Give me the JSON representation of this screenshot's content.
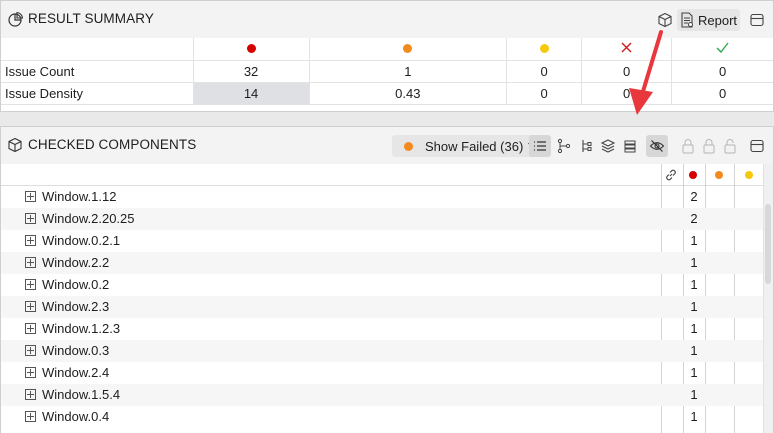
{
  "summary": {
    "title": "RESULT SUMMARY",
    "report_label": "Report",
    "status_colors": [
      "#d60000",
      "#f28a1e",
      "#f6c90e",
      "#d01818",
      "#2fa84f"
    ],
    "rows": [
      {
        "label": "Issue Count",
        "values": [
          "32",
          "1",
          "0",
          "0",
          "0"
        ]
      },
      {
        "label": "Issue Density",
        "values": [
          "14",
          "0.43",
          "0",
          "0",
          "0"
        ]
      }
    ]
  },
  "components": {
    "title": "CHECKED COMPONENTS",
    "filter_label": "Show Failed (36)",
    "items": [
      {
        "name": "Window.1.12",
        "count": "2"
      },
      {
        "name": "Window.2.20.25",
        "count": "2"
      },
      {
        "name": "Window.0.2.1",
        "count": "1"
      },
      {
        "name": "Window.2.2",
        "count": "1"
      },
      {
        "name": "Window.0.2",
        "count": "1"
      },
      {
        "name": "Window.2.3",
        "count": "1"
      },
      {
        "name": "Window.1.2.3",
        "count": "1"
      },
      {
        "name": "Window.0.3",
        "count": "1"
      },
      {
        "name": "Window.2.4",
        "count": "1"
      },
      {
        "name": "Window.1.5.4",
        "count": "1"
      },
      {
        "name": "Window.0.4",
        "count": "1"
      }
    ]
  },
  "annotation": {
    "arrow_color": "#e8383d"
  }
}
